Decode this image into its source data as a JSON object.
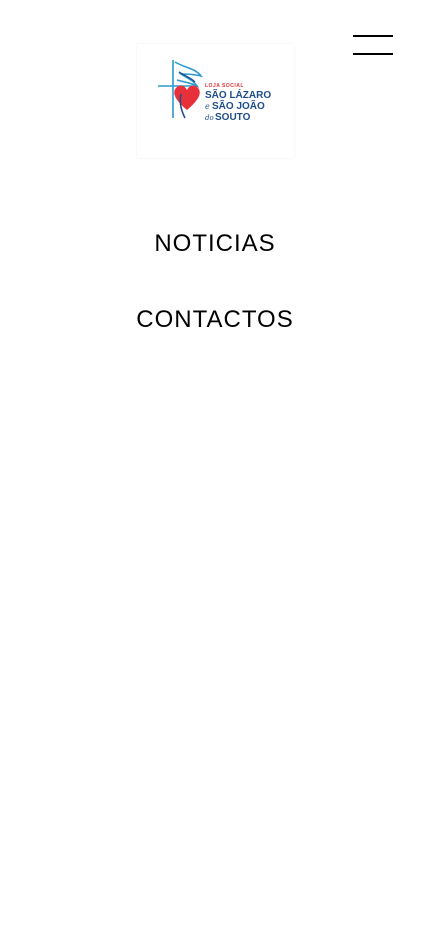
{
  "header": {
    "menu_icon": "hamburger-icon",
    "logo": {
      "icon": "dove-heart-cross-logo",
      "small_text": "LOJA SOCIAL",
      "line1": "SÃO LÁZARO",
      "line2_prefix": "e",
      "line2": "SÃO JOÃO",
      "line3_prefix": "do",
      "line3": "SOUTO",
      "colors": {
        "blue": "#1f4e8c",
        "red": "#e8303a",
        "teal": "#2a9bd0"
      }
    }
  },
  "nav": {
    "items": [
      {
        "label": "NOTICIAS"
      },
      {
        "label": "CONTACTOS"
      }
    ]
  }
}
